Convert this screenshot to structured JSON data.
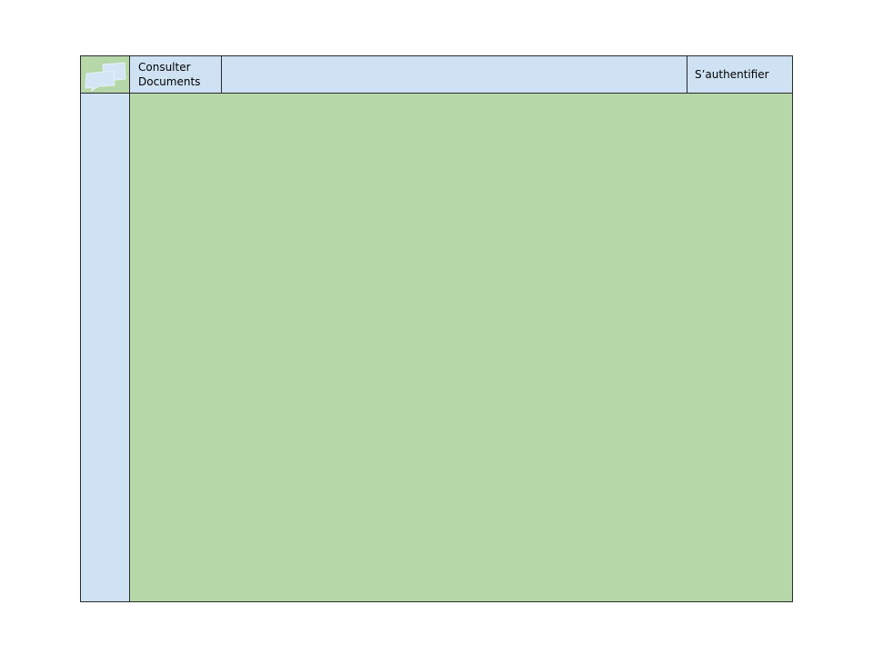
{
  "header": {
    "logo_icon": "chat-bubbles-icon",
    "nav_link": {
      "line1": "Consulter",
      "line2": "Documents"
    },
    "auth_button": "S’authentifier"
  },
  "colors": {
    "header_bg": "#cfe2f3",
    "sidebar_bg": "#cfe2f3",
    "content_bg": "#b6d7a8",
    "logo_bg": "#b6d7a8",
    "border": "#2b2b2b"
  }
}
